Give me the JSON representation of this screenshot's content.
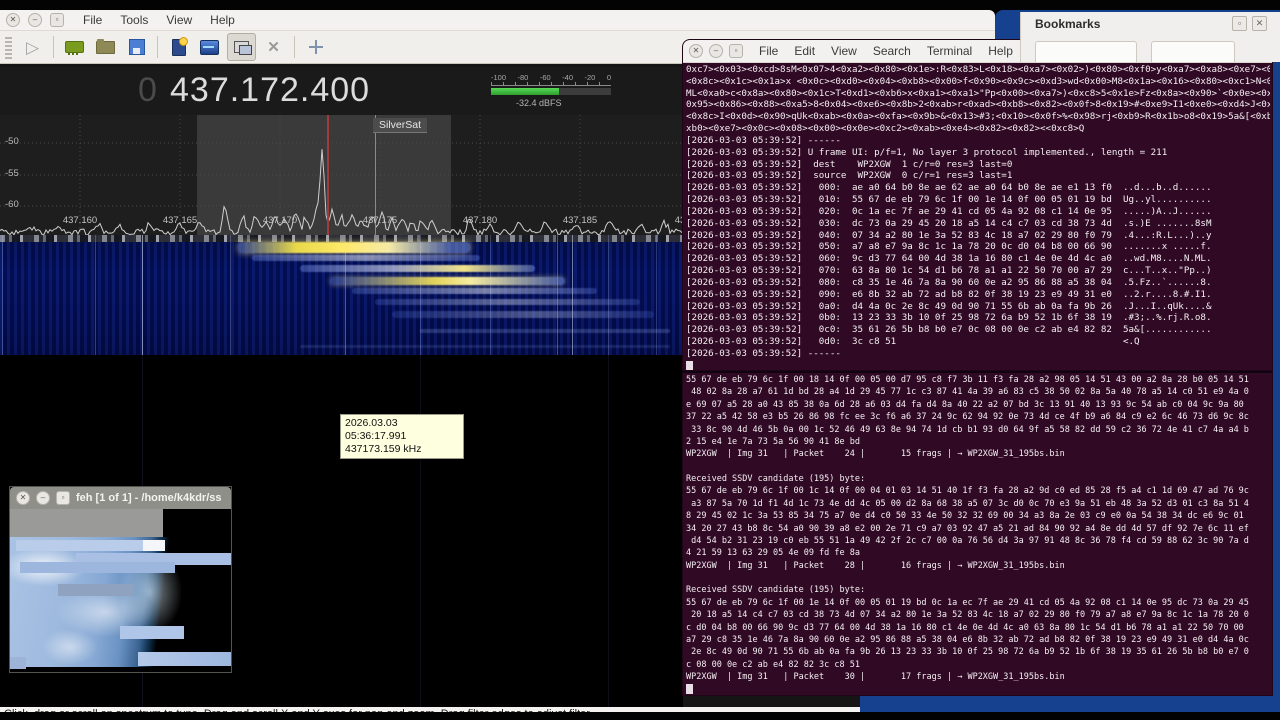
{
  "gqrx": {
    "menus": [
      "File",
      "Tools",
      "View",
      "Help"
    ],
    "toolbar_icons": [
      "play-icon",
      "iq-ram-icon",
      "open-folder-icon",
      "save-floppy-icon",
      "new-bookmark-icon",
      "spectrum-display-icon",
      "remote-control-icon",
      "tools-icon",
      "pan-arrows-icon"
    ],
    "freq_leading": "0",
    "freq_display": "437.172.400",
    "meter_ticks": [
      "-100",
      "-80",
      "-60",
      "-40",
      "-20",
      "0"
    ],
    "meter_reading": "-32.4 dBFS",
    "spectrum": {
      "y_ticks": [
        "-50",
        "-55",
        "-60"
      ],
      "x_ticks": [
        "437.160",
        "437.165",
        "437.170",
        "437.175",
        "437.180",
        "437.185",
        "437."
      ],
      "bookmark_label": "SilverSat",
      "accent_colors": {
        "tuning_line": "#a23b3b",
        "signal_trace": "#ffe96a",
        "waterfall_base": "#000c52"
      }
    },
    "status_text": "Click, drag or scroll on spectrum to tune. Drag and scroll X and Y axes for pan and zoom. Drag filter edges to adjust filter."
  },
  "tooltip": {
    "line1": "2026.03.03 05:36:17.991",
    "line2": "437173.159 kHz"
  },
  "bookmarks": {
    "title": "Bookmarks"
  },
  "terminal": {
    "menus": [
      "File",
      "Edit",
      "View",
      "Search",
      "Terminal",
      "Help"
    ]
  },
  "terminal1": {
    "lines": [
      "0xc7><0x03><0xcd>8sM<0x07>4<0xa2><0x80><0x1e>:R<0x83>L<0x18><0xa7><0x02>)<0x80><0xf0>y<0xa7><0xa8><0xe7><0x9a>",
      "<0x8c><0x1c><0x1a>x <0x0c><0xd0><0x04><0xb8><0x00>f<0x90><0x9c><0xd3>wd<0x00>M8<0x1a><0x16><0x80><0xc1>N<0x0e>",
      "ML<0xa0>c<0x8a><0x80><0x1c>T<0xd1><0xb6>x<0xa1><0xa1>\"Pp<0x00><0xa7>)<0xc8>5<0x1e>Fz<0x8a><0x90>`<0x0e><0xa2><",
      "0x95><0x86><0x88><0xa5>8<0x04><0xe6><0x8b>2<0xab>r<0xad><0xb8><0x82><0x0f>8<0x19>#<0xe9>I1<0xe0><0xd4>J<0x0c>.",
      "<0x8c>I<0x0d><0x90>qUk<0xab><0x0a><0xfa><0x9b>&<0x13>#3;<0x10><0x0f>%<0x98>rj<0xb9>R<0x1b>o8<0x19>5a&[<0xb8><0",
      "xb0><0xe7><0x0c><0x08><0x00><0x0e><0xc2><0xab><0xe4><0x82><0x82><<0xc8>Q",
      "[2026-03-03 05:39:52] ------",
      "[2026-03-03 05:39:52] U frame UI: p/f=1, No layer 3 protocol implemented., length = 211",
      "[2026-03-03 05:39:52]  dest    WP2XGW  1 c/r=0 res=3 last=0",
      "[2026-03-03 05:39:52]  source  WP2XGW  0 c/r=1 res=3 last=1",
      "[2026-03-03 05:39:52]   000:  ae a0 64 b0 8e ae 62 ae a0 64 b0 8e ae e1 13 f0  ..d...b..d......",
      "[2026-03-03 05:39:52]   010:  55 67 de eb 79 6c 1f 00 1e 14 0f 00 05 01 19 bd  Ug..yl..........",
      "[2026-03-03 05:39:52]   020:  0c 1a ec 7f ae 29 41 cd 05 4a 92 08 c1 14 0e 95  .....)A..J......",
      "[2026-03-03 05:39:52]   030:  dc 73 0a 29 45 20 18 a5 14 c4 c7 03 cd 38 73 4d  .s.)E .......8sM",
      "[2026-03-03 05:39:52]   040:  07 34 a2 80 1e 3a 52 83 4c 18 a7 02 29 80 f0 79  .4...:R.L...)..y",
      "[2026-03-03 05:39:52]   050:  a7 a8 e7 9a 8c 1c 1a 78 20 0c d0 04 b8 00 66 90  .......x .....f.",
      "[2026-03-03 05:39:52]   060:  9c d3 77 64 00 4d 38 1a 16 80 c1 4e 0e 4d 4c a0  ..wd.M8....N.ML.",
      "[2026-03-03 05:39:52]   070:  63 8a 80 1c 54 d1 b6 78 a1 a1 22 50 70 00 a7 29  c...T..x..\"Pp..)",
      "[2026-03-03 05:39:52]   080:  c8 35 1e 46 7a 8a 90 60 0e a2 95 86 88 a5 38 04  .5.Fz..`......8.",
      "[2026-03-03 05:39:52]   090:  e6 8b 32 ab 72 ad b8 82 0f 38 19 23 e9 49 31 e0  ..2.r....8.#.I1.",
      "[2026-03-03 05:39:52]   0a0:  d4 4a 0c 2e 8c 49 0d 90 71 55 6b ab 0a fa 9b 26  .J...I..qUk....&",
      "[2026-03-03 05:39:52]   0b0:  13 23 33 3b 10 0f 25 98 72 6a b9 52 1b 6f 38 19  .#3;..%.rj.R.o8.",
      "[2026-03-03 05:39:52]   0c0:  35 61 26 5b b8 b0 e7 0c 08 00 0e c2 ab e4 82 82  5a&[............",
      "[2026-03-03 05:39:52]   0d0:  3c c8 51                                         <.Q",
      "[2026-03-03 05:39:52] ------"
    ]
  },
  "terminal2": {
    "lines": [
      "55 67 de eb 79 6c 1f 00 18 14 0f 00 05 00 d7 95 c8 f7 3b 11 f3 fa 28 a2 98 05 14 51 43 00 a2 8a 28 b0 05 14 51",
      " 48 02 8a 28 a7 61 1d bd 28 a4 1d 29 45 77 1c c3 87 41 4a 39 a6 83 c5 38 50 02 8a 5a 40 78 a5 14 c0 51 e9 4a 0",
      "e 69 07 a5 28 a0 43 85 38 0a 6d 28 a6 03 d4 fa d4 8a 40 22 a2 07 bd 3c 13 91 40 13 93 9c 54 ab c0 04 9c 9a 80",
      "37 22 a5 42 58 e3 b5 26 86 98 fc ee 3c f6 a6 37 24 9c 62 94 92 0e 73 4d ce 4f b9 a6 84 c9 e2 6c 46 73 d6 9c 8c",
      " 33 8c 90 4d 46 5b 0a 00 1c 52 46 49 63 8e 94 74 1d cb b1 93 d0 64 9f a5 58 82 dd 59 c2 36 72 4e 41 c7 4a a4 b",
      "2 15 e4 1e 7a 73 5a 56 90 41 8e bd",
      "WP2XGW  | Img 31   | Packet    24 |       15 frags | → WP2XGW_31_195bs.bin",
      "",
      "Received SSDV candidate (195) byte:",
      "55 67 de eb 79 6c 1f 00 1c 14 0f 00 04 01 03 14 51 40 1f f3 fa 28 a2 9d c0 ed 85 28 f5 a4 c1 1d 69 47 ad 76 9c",
      " a3 87 5a 70 1d f1 4d 1c 73 4e dd 4c 05 00 d2 8a 68 38 a5 07 3c d0 0c 70 e3 9a 51 eb 48 3a 52 d3 01 c3 8a 51 4",
      "8 29 45 02 1c 3a 53 85 34 75 a7 0e d4 c0 50 33 4e 50 32 32 69 00 34 a3 8a 2e 03 c9 e0 0a 54 38 34 dc e6 9c 01",
      "34 20 27 43 b8 8c 54 a0 90 39 a8 e2 00 2e 71 c9 a7 03 92 47 a5 21 ad 84 90 92 a4 8e dd 4d 57 df 92 7e 6c 11 ef",
      " d4 54 b2 31 23 19 c0 eb 55 51 1a 49 42 2f 2c c7 00 0a 76 56 d4 3a 97 91 48 8c 36 78 f4 cd 59 88 62 3c 90 7a d",
      "4 21 59 13 63 29 05 4e 09 fd fe 8a",
      "WP2XGW  | Img 31   | Packet    28 |       16 frags | → WP2XGW_31_195bs.bin",
      "",
      "Received SSDV candidate (195) byte:",
      "55 67 de eb 79 6c 1f 00 1e 14 0f 00 05 01 19 bd 0c 1a ec 7f ae 29 41 cd 05 4a 92 08 c1 14 0e 95 dc 73 0a 29 45",
      " 20 18 a5 14 c4 c7 03 cd 38 73 4d 07 34 a2 80 1e 3a 52 83 4c 18 a7 02 29 80 f0 79 a7 a8 e7 9a 8c 1c 1a 78 20 0",
      "c d0 04 b8 00 66 90 9c d3 77 64 00 4d 38 1a 16 80 c1 4e 0e 4d 4c a0 63 8a 80 1c 54 d1 b6 78 a1 a1 22 50 70 00",
      "a7 29 c8 35 1e 46 7a 8a 90 60 0e a2 95 86 88 a5 38 04 e6 8b 32 ab 72 ad b8 82 0f 38 19 23 e9 49 31 e0 d4 4a 0c",
      " 2e 8c 49 0d 90 71 55 6b ab 0a fa 9b 26 13 23 33 3b 10 0f 25 98 72 6a b9 52 1b 6f 38 19 35 61 26 5b b8 b0 e7 0",
      "c 08 00 0e c2 ab e4 82 82 3c c8 51",
      "WP2XGW  | Img 31   | Packet    30 |       17 frags | → WP2XGW_31_195bs.bin"
    ]
  },
  "feh": {
    "title": "feh [1 of 1] - /home/k4kdr/ss"
  }
}
